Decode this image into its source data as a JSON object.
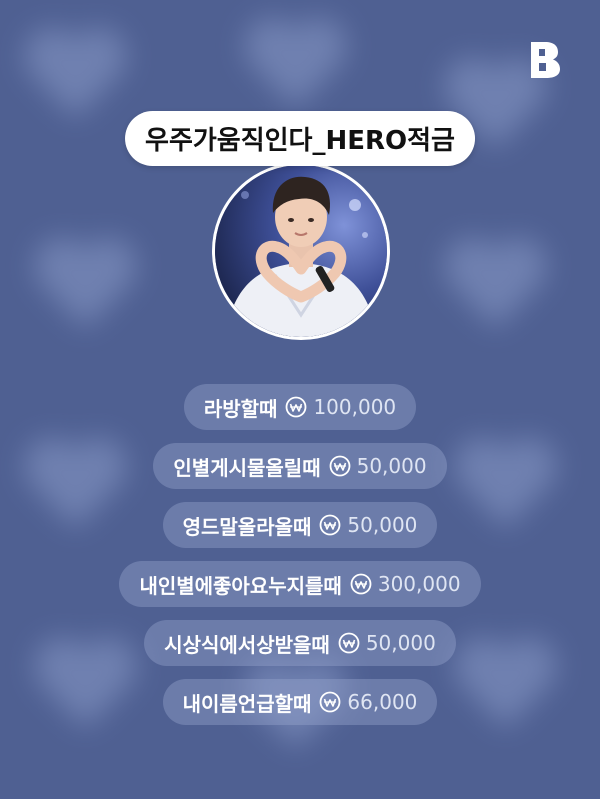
{
  "header": {
    "title": "우주가움직인다_HERO적금",
    "brand_icon": "band-b-logo-icon"
  },
  "profile": {
    "avatar_icon": "profile-photo"
  },
  "savings": {
    "currency_icon": "won-coin-icon",
    "items": [
      {
        "label": "라방할때",
        "amount": "100,000"
      },
      {
        "label": "인별게시물올릴때",
        "amount": "50,000"
      },
      {
        "label": "영드말올라올때",
        "amount": "50,000"
      },
      {
        "label": "내인별에좋아요누지를때",
        "amount": "300,000"
      },
      {
        "label": "시상식에서상받을때",
        "amount": "50,000"
      },
      {
        "label": "내이름언급할때",
        "amount": "66,000"
      }
    ]
  },
  "colors": {
    "background": "#4f6092",
    "pill": "#ffffff",
    "item_bg": "#7d8dbb"
  }
}
